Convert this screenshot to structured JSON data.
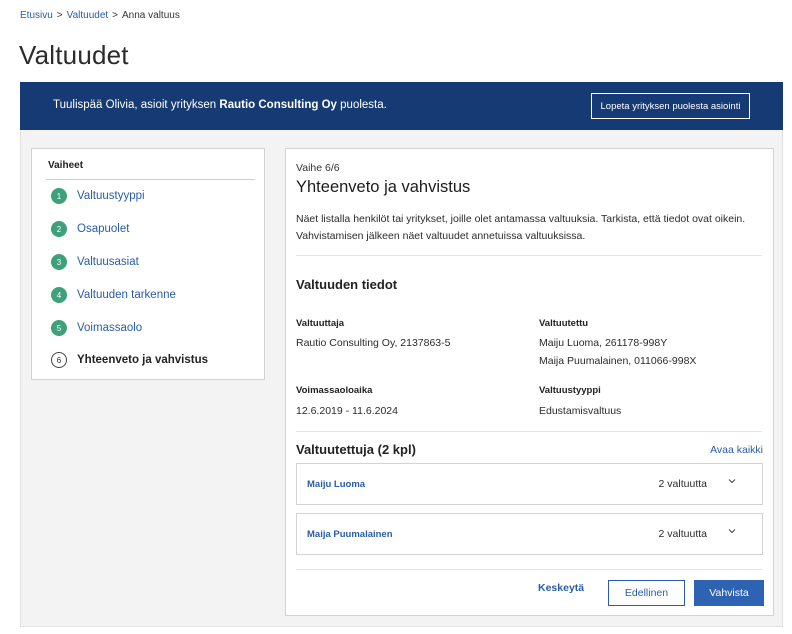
{
  "breadcrumb": {
    "items": [
      {
        "label": "Etusivu"
      },
      {
        "label": "Valtuudet"
      },
      {
        "label": "Anna valtuus"
      }
    ],
    "separator": ">"
  },
  "page_title": "Valtuudet",
  "banner": {
    "prefix": "Tuulispää Olivia, asioit yrityksen ",
    "company": "Rautio Consulting Oy",
    "suffix": " puolesta.",
    "button_label": "Lopeta yrityksen puolesta asiointi"
  },
  "steps": {
    "title": "Vaiheet",
    "items": [
      {
        "num": "1",
        "label": "Valtuustyyppi"
      },
      {
        "num": "2",
        "label": "Osapuolet"
      },
      {
        "num": "3",
        "label": "Valtuusasiat"
      },
      {
        "num": "4",
        "label": "Valtuuden tarkenne"
      },
      {
        "num": "5",
        "label": "Voimassaolo"
      },
      {
        "num": "6",
        "label": "Yhteenveto ja vahvistus"
      }
    ]
  },
  "content": {
    "phase": "Vaihe 6/6",
    "title": "Yhteenveto ja vahvistus",
    "description": "Näet listalla henkilöt tai yritykset, joille olet antamassa valtuuksia. Tarkista, että tiedot ovat oikein. Vahvistamisen jälkeen näet valtuudet annetuissa valtuuksissa.",
    "section_title": "Valtuuden tiedot",
    "fields": {
      "grantor_label": "Valtuuttaja",
      "grantor_value": "Rautio Consulting Oy, 2137863-5",
      "grantee_label": "Valtuutettu",
      "grantee_value_1": "Maiju Luoma, 261178-998Y",
      "grantee_value_2": "Maija Puumalainen, 011066-998X",
      "validity_label": "Voimassaoloaika",
      "validity_value": "12.6.2019 - 11.6.2024",
      "type_label": "Valtuustyyppi",
      "type_value": "Edustamisvaltuus"
    },
    "grantees_title": "Valtuutettuja (2 kpl)",
    "open_all": "Avaa kaikki",
    "grantees": [
      {
        "name": "Maiju Luoma",
        "count": "2 valtuutta"
      },
      {
        "name": "Maija Puumalainen",
        "count": "2 valtuutta"
      }
    ],
    "actions": {
      "cancel": "Keskeytä",
      "previous": "Edellinen",
      "confirm": "Vahvista"
    }
  },
  "icons": {
    "chevron": "chevron-down-icon"
  },
  "colors": {
    "banner": "#163a73",
    "link": "#2a5ca8",
    "step_done": "#3fa07d",
    "primary_button": "#2e62b2"
  }
}
